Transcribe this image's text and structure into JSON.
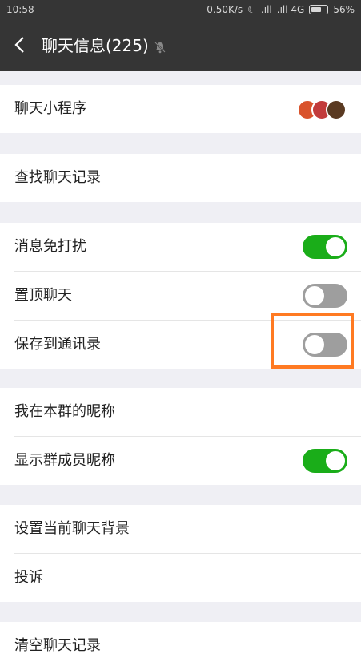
{
  "status": {
    "time": "10:58",
    "net_speed": "0.50K/s",
    "signal1": ".ıll",
    "signal2": ".ıll 4G",
    "battery": "56%"
  },
  "header": {
    "title": "聊天信息(225)"
  },
  "sections": [
    {
      "items": [
        {
          "label": "聊天小程序"
        }
      ]
    },
    {
      "items": [
        {
          "label": "查找聊天记录"
        }
      ]
    },
    {
      "items": [
        {
          "label": "消息免打扰",
          "toggle": true
        },
        {
          "label": "置顶聊天",
          "toggle": false
        },
        {
          "label": "保存到通讯录",
          "toggle": false
        }
      ]
    },
    {
      "items": [
        {
          "label": "我在本群的昵称"
        },
        {
          "label": "显示群成员昵称",
          "toggle": true
        }
      ]
    },
    {
      "items": [
        {
          "label": "设置当前聊天背景"
        },
        {
          "label": "投诉"
        }
      ]
    },
    {
      "items": [
        {
          "label": "清空聊天记录"
        }
      ]
    }
  ],
  "colors": {
    "toggle_on": "#1aad19",
    "toggle_off": "#9e9e9e",
    "highlight": "#ff7a22",
    "header_bg": "#353535"
  }
}
